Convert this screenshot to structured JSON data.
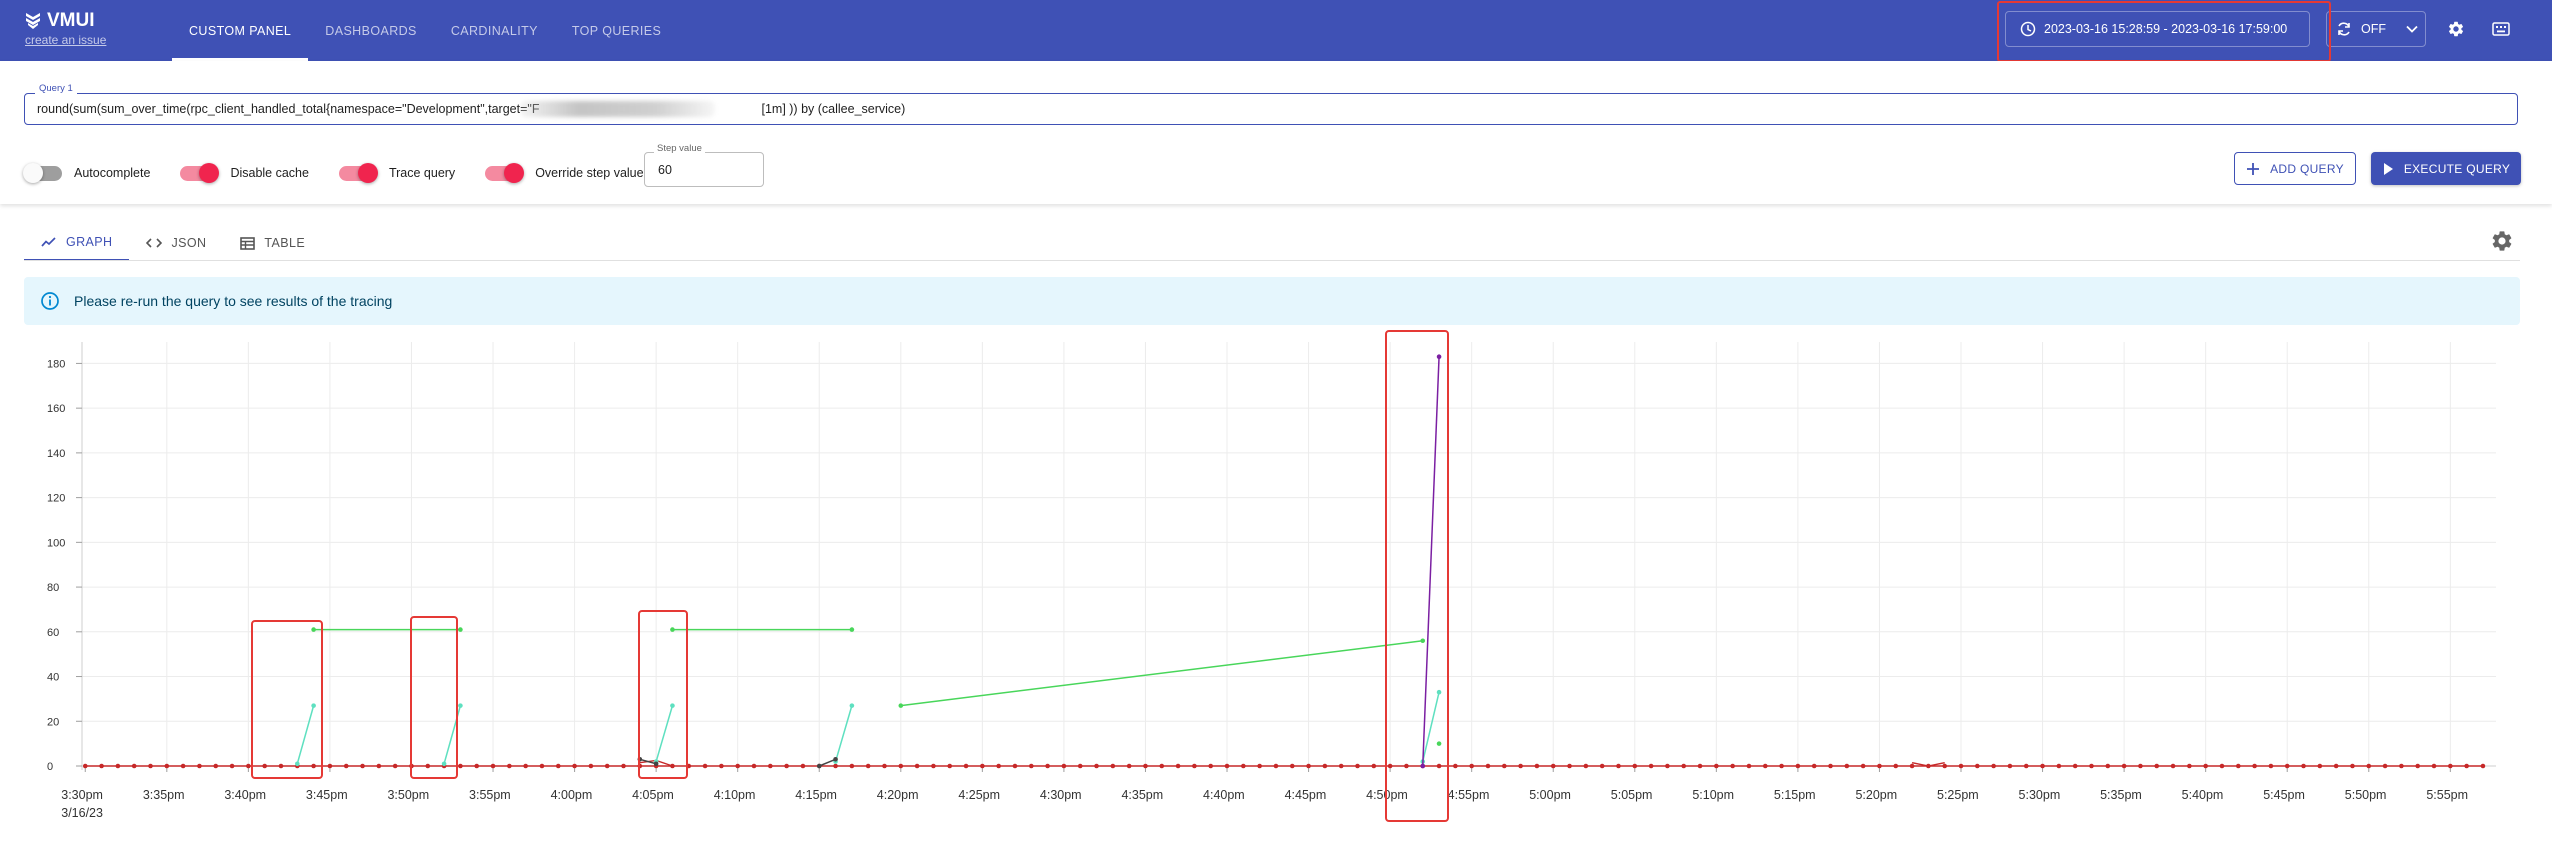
{
  "app": {
    "logo_text": "VMUI",
    "issue_link": "create an issue"
  },
  "nav": {
    "tabs": [
      {
        "label": "CUSTOM PANEL",
        "active": true
      },
      {
        "label": "DASHBOARDS",
        "active": false
      },
      {
        "label": "CARDINALITY",
        "active": false
      },
      {
        "label": "TOP QUERIES",
        "active": false
      }
    ]
  },
  "header": {
    "time_range": "2023-03-16 15:28:59 - 2023-03-16 17:59:00",
    "refresh_label": "OFF",
    "icons": [
      "clock-icon",
      "refresh-icon",
      "chevron-down-icon",
      "settings-icon",
      "keyboard-icon"
    ]
  },
  "query": {
    "label": "Query 1",
    "value_start": "round(sum(sum_over_time(rpc_client_handled_total{namespace=\"Development\",target=\"F",
    "value_end": "[1m] )) by (callee_service)"
  },
  "options": {
    "autocomplete": {
      "label": "Autocomplete",
      "on": false
    },
    "disable_cache": {
      "label": "Disable cache",
      "on": true
    },
    "trace_query": {
      "label": "Trace query",
      "on": true
    },
    "override_step": {
      "label": "Override step value",
      "on": true
    },
    "step_label": "Step value",
    "step_value": "60"
  },
  "buttons": {
    "add_query": "ADD QUERY",
    "execute_query": "EXECUTE QUERY"
  },
  "result_tabs": [
    {
      "label": "GRAPH",
      "icon": "line-chart-icon",
      "active": true
    },
    {
      "label": "JSON",
      "icon": "code-icon",
      "active": false
    },
    {
      "label": "TABLE",
      "icon": "table-icon",
      "active": false
    }
  ],
  "info_message": "Please re-run the query to see results of the tracing",
  "colors": {
    "accent": "#3f51b5",
    "red_series": "#c62828",
    "teal_series": "#5ee0c0",
    "green_series": "#48d65a",
    "purple_series": "#7b1fa2",
    "annotation": "#e53935"
  },
  "chart_data": {
    "type": "line",
    "x_date_label": "3/16/23",
    "x_tick_labels": [
      "3:30pm",
      "3:35pm",
      "3:40pm",
      "3:45pm",
      "3:50pm",
      "3:55pm",
      "4:00pm",
      "4:05pm",
      "4:10pm",
      "4:15pm",
      "4:20pm",
      "4:25pm",
      "4:30pm",
      "4:35pm",
      "4:40pm",
      "4:45pm",
      "4:50pm",
      "4:55pm",
      "5:00pm",
      "5:05pm",
      "5:10pm",
      "5:15pm",
      "5:20pm",
      "5:25pm",
      "5:30pm",
      "5:35pm",
      "5:40pm",
      "5:45pm",
      "5:50pm",
      "5:55pm"
    ],
    "y_ticks": [
      0,
      20,
      40,
      60,
      80,
      100,
      120,
      140,
      160,
      180
    ],
    "ylim": [
      0,
      186
    ],
    "x_range_minutes": [
      -0.2,
      147.8
    ],
    "grid": true,
    "series": [
      {
        "color": "#c62828",
        "kind": "flat-zero",
        "x_minutes": [
          0,
          147
        ],
        "step": 1,
        "values_all": 0,
        "excursions": [
          {
            "x": [
              34,
              35,
              36
            ],
            "y": [
              1.5,
              2.5,
              0
            ]
          },
          {
            "x": [
              112,
              113,
              114
            ],
            "y": [
              1.5,
              0,
              1.5
            ]
          }
        ]
      },
      {
        "color": "#5ee0c0",
        "x": [
          13,
          14,
          22,
          23,
          35,
          36,
          46,
          47,
          48
        ],
        "y": [
          1,
          27,
          1,
          27,
          2,
          27,
          2,
          27,
          null
        ],
        "segments": [
          [
            13,
            1
          ],
          [
            14,
            27
          ]
        ]
      },
      {
        "color": "#48d65a",
        "x": [
          14,
          23,
          36,
          47,
          50,
          82,
          83
        ],
        "y": [
          61,
          61,
          61,
          61,
          27,
          56,
          10
        ]
      },
      {
        "color": "#5ee0c0",
        "x": [
          82,
          83
        ],
        "y": [
          2,
          33
        ]
      },
      {
        "color": "#7b1fa2",
        "x": [
          82,
          83
        ],
        "y": [
          0,
          183
        ]
      },
      {
        "color": "#444444",
        "x": [
          34,
          35,
          45,
          46
        ],
        "y": [
          3,
          1,
          0,
          3
        ]
      }
    ]
  },
  "annotations": {
    "count": 5
  }
}
